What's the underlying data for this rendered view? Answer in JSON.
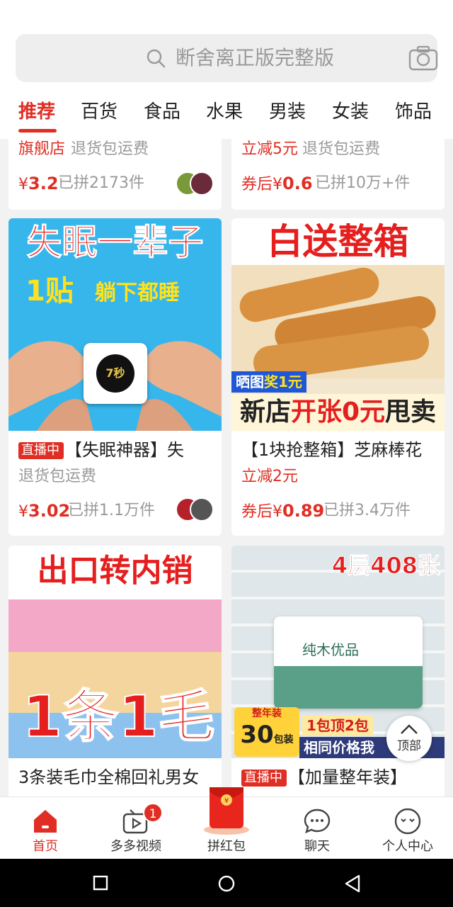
{
  "search": {
    "placeholder_text": "断舍离正版完整版"
  },
  "tabs": [
    {
      "label": "推荐",
      "active": true
    },
    {
      "label": "百货"
    },
    {
      "label": "食品"
    },
    {
      "label": "水果"
    },
    {
      "label": "男装"
    },
    {
      "label": "女装"
    },
    {
      "label": "饰品"
    }
  ],
  "products": [
    {
      "tags": [
        "旗舰店",
        "退货包运费"
      ],
      "price_symbol": "¥",
      "price": "3.2",
      "sold": "已拼2173件"
    },
    {
      "tags": [
        "立减5元",
        "退货包运费"
      ],
      "price_prefix": "券后",
      "price_symbol": "¥",
      "price": "0.6",
      "sold": "已拼10万+件"
    },
    {
      "image_banner_top": "失眠一辈子",
      "image_banner_sub_a": "1贴",
      "image_banner_sub_b": "躺下都睡",
      "image_logo": "7秒",
      "live_badge": "直播中",
      "title": "【失眠神器】失",
      "tags": [
        "退货包运费"
      ],
      "price_symbol": "¥",
      "price": "3.02",
      "sold": "已拼1.1万件"
    },
    {
      "image_banner_top": "白送整箱",
      "image_badge": "晒图奖1元",
      "image_badge_a": "晒图",
      "image_badge_b": "奖1元",
      "image_banner_bottom_a": "新店",
      "image_banner_bottom_b": "开张0元",
      "image_banner_bottom_c": "甩卖",
      "title": "【1块抢整箱】芝麻棒花",
      "tags": [
        "立减2元"
      ],
      "price_prefix": "券后",
      "price_symbol": "¥",
      "price": "0.89",
      "sold": "已拼3.4万件"
    },
    {
      "image_banner_top": "出口转内销",
      "image_banner_big_a": "1",
      "image_banner_big_b": "条",
      "image_banner_big_c": "1",
      "image_banner_big_d": "毛",
      "title": "3条装毛巾全棉回礼男女"
    },
    {
      "image_banner_top": "4层408张",
      "image_pack_text": "纯木优品",
      "image_corner_a": "整年装",
      "image_corner_b": "30",
      "image_corner_c": "包装",
      "image_strip_a": "1包顶2包",
      "image_strip_b": "相同价格我",
      "live_badge": "直播中",
      "title": "【加量整年装】"
    }
  ],
  "scroll_top_label": "顶部",
  "bottom_nav": [
    {
      "label": "首页",
      "icon": "home-icon",
      "active": true
    },
    {
      "label": "多多视频",
      "icon": "video-icon",
      "badge": "1"
    },
    {
      "label": "拼红包",
      "icon": "red-envelope-icon"
    },
    {
      "label": "聊天",
      "icon": "chat-icon"
    },
    {
      "label": "个人中心",
      "icon": "profile-icon"
    }
  ],
  "system_nav": [
    "recent-apps-icon",
    "home-circle-icon",
    "back-icon"
  ],
  "colors": {
    "accent": "#e02e24",
    "feed_bg": "#f2f2f2",
    "placeholder": "#9a9a9a"
  }
}
